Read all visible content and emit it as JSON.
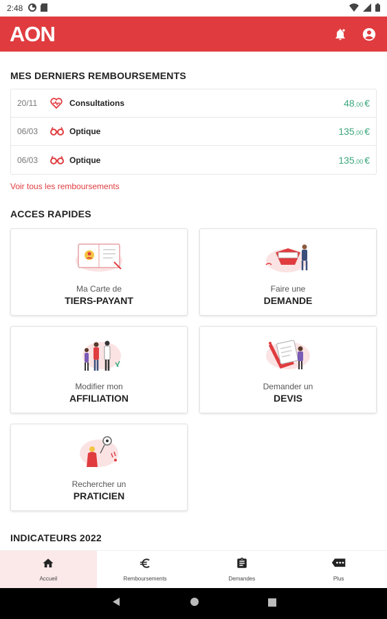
{
  "status_bar": {
    "time": "2:48"
  },
  "app_bar": {
    "logo": "AON"
  },
  "recent": {
    "title": "MES DERNIERS REMBOURSEMENTS",
    "rows": [
      {
        "date": "20/11",
        "icon": "heart-stethoscope-icon",
        "label": "Consultations",
        "amount_int": "48",
        "amount_cents": ",00",
        "currency": "€"
      },
      {
        "date": "06/03",
        "icon": "glasses-icon",
        "label": "Optique",
        "amount_int": "135",
        "amount_cents": ",00",
        "currency": "€"
      },
      {
        "date": "06/03",
        "icon": "glasses-icon",
        "label": "Optique",
        "amount_int": "135",
        "amount_cents": ",00",
        "currency": "€"
      }
    ],
    "see_all": "Voir tous les remboursements"
  },
  "quick_access": {
    "title": "ACCES RAPIDES",
    "cards": [
      {
        "line1": "Ma Carte de",
        "line2": "TIERS-PAYANT"
      },
      {
        "line1": "Faire une",
        "line2": "DEMANDE"
      },
      {
        "line1": "Modifier mon",
        "line2": "AFFILIATION"
      },
      {
        "line1": "Demander un",
        "line2": "DEVIS"
      },
      {
        "line1": "Rechercher un",
        "line2": "PRATICIEN"
      }
    ]
  },
  "indicators": {
    "title": "INDICATEURS 2022"
  },
  "bottom_nav": {
    "items": [
      {
        "label": "Accueil",
        "icon": "home-icon"
      },
      {
        "label": "Remboursements",
        "icon": "euro-icon"
      },
      {
        "label": "Demandes",
        "icon": "clipboard-icon"
      },
      {
        "label": "Plus",
        "icon": "more-icon"
      }
    ]
  },
  "colors": {
    "brand": "#e03c3f",
    "amount": "#3aa77a",
    "active_tab_bg": "#fbe9ea"
  }
}
